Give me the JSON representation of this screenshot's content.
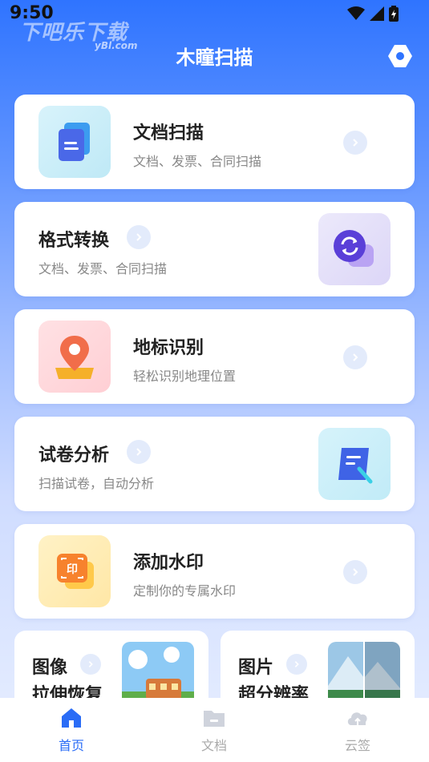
{
  "status": {
    "time": "9:50"
  },
  "watermark": {
    "main": "下吧乐下载",
    "sub": "yBl.com"
  },
  "header": {
    "title": "木瞳扫描"
  },
  "features": [
    {
      "title": "文档扫描",
      "subtitle": "文档、发票、合同扫描"
    },
    {
      "title": "格式转换",
      "subtitle": "文档、发票、合同扫描"
    },
    {
      "title": "地标识别",
      "subtitle": "轻松识别地理位置"
    },
    {
      "title": "试卷分析",
      "subtitle": "扫描试卷，自动分析"
    },
    {
      "title": "添加水印",
      "subtitle": "定制你的专属水印"
    }
  ],
  "small_cards": [
    {
      "title_line1": "图像",
      "title_line2": "拉伸恢复"
    },
    {
      "title_line1": "图片",
      "title_line2": "超分辨率"
    }
  ],
  "tabs": [
    {
      "label": "首页"
    },
    {
      "label": "文档"
    },
    {
      "label": "云签"
    }
  ],
  "colors": {
    "accent": "#2a6cf6",
    "header_bg": "#2f74ff"
  }
}
